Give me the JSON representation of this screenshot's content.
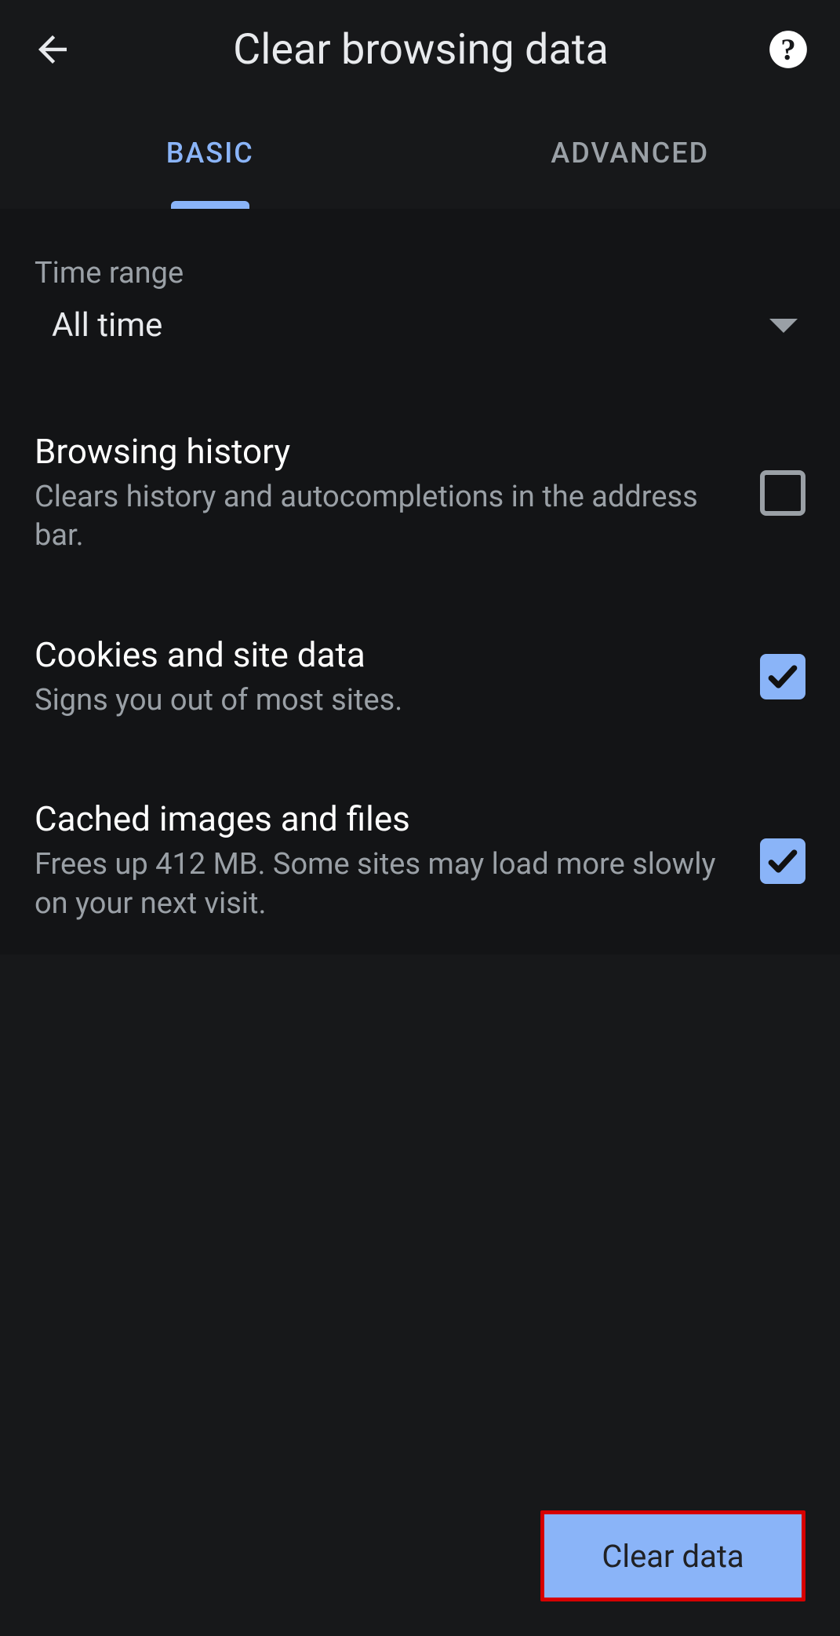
{
  "header": {
    "title": "Clear browsing data"
  },
  "tabs": {
    "basic": "BASIC",
    "advanced": "ADVANCED"
  },
  "time_range": {
    "label": "Time range",
    "value": "All time"
  },
  "items": [
    {
      "title": "Browsing history",
      "subtitle": "Clears history and autocompletions in the address bar.",
      "checked": false
    },
    {
      "title": "Cookies and site data",
      "subtitle": "Signs you out of most sites.",
      "checked": true
    },
    {
      "title": "Cached images and files",
      "subtitle": "Frees up 412 MB. Some sites may load more slowly on your next visit.",
      "checked": true
    }
  ],
  "action": {
    "label": "Clear data"
  }
}
